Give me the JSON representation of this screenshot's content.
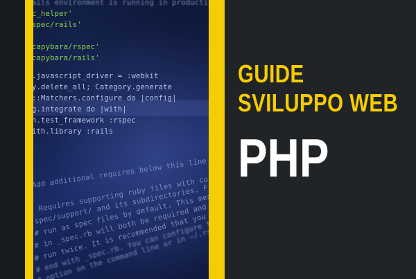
{
  "banner": {
    "line1": "GUIDE",
    "line2": "SVILUPPO WEB",
    "topic": "PHP"
  },
  "code_image": {
    "lines": [
      "ails environment is running in production')",
      "c_helper'",
      "spec/rails'",
      "capybara/rspec'",
      "capybara/rails'",
      ".javascript_driver = :webkit",
      "y.delete_all; Category.generate",
      "::Matchers.configure do |config|",
      "g.integrate do |with|",
      "h.test_framework :rspec",
      "ith.library :rails",
      "Add additional requires below this line. Rails is not loaded",
      "Requires supporting ruby files with custom matchers and macros",
      "spec/support/ and its subdirectories. Files matching",
      "# run as spec files by default. This means that files",
      "# in _spec.rb will both be required and run as specs",
      "# run twice. It is recommended that you do not name files",
      "# end with _spec.rb. You can configure this pattern with",
      "# option on the command line or in ~/.rspec"
    ]
  },
  "colors": {
    "accent_yellow": "#f5cc00",
    "background": "#212426",
    "code_background": "#121d45"
  }
}
